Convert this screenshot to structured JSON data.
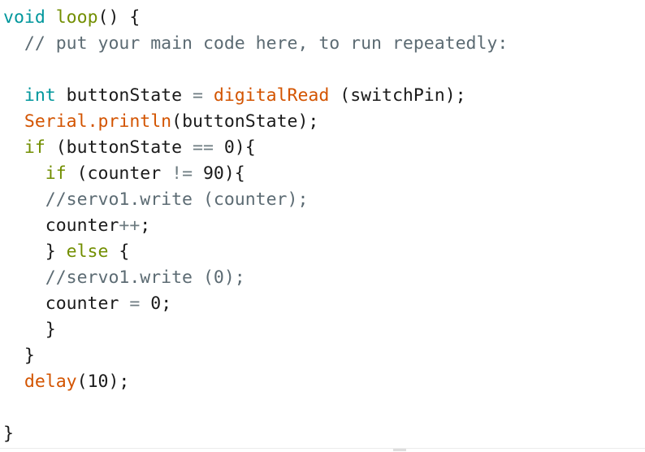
{
  "editor": {
    "language": "arduino",
    "background_color": "#ffffff",
    "font_size_px": 21.5,
    "line_height_px": 32,
    "colors": {
      "type": "#00979C",
      "keyword": "#728E00",
      "function": "#D35400",
      "comment": "#5C6B73",
      "operator": "#6D7B80",
      "plain": "#1a1a1a",
      "divider": "#ececec"
    },
    "full_text": "void loop() {\n  // put your main code here, to run repeatedly:\n\n  int buttonState = digitalRead (switchPin);\n  Serial.println(buttonState);\n  if (buttonState == 0){\n    if (counter != 90){\n    //servo1.write (counter);\n    counter++;\n    } else {\n    //servo1.write (0);\n    counter = 0;\n    }\n  }\n  delay(10);\n\n}",
    "lines": [
      {
        "indent": "",
        "tokens": [
          {
            "t": "void",
            "k": "type"
          },
          {
            "t": " ",
            "k": "plain"
          },
          {
            "t": "loop",
            "k": "keyword"
          },
          {
            "t": "() {",
            "k": "punct"
          }
        ]
      },
      {
        "indent": "  ",
        "tokens": [
          {
            "t": "// put your main code here, to run repeatedly:",
            "k": "comment"
          }
        ]
      },
      {
        "indent": "",
        "tokens": []
      },
      {
        "indent": "  ",
        "tokens": [
          {
            "t": "int",
            "k": "type"
          },
          {
            "t": " buttonState ",
            "k": "plain"
          },
          {
            "t": "=",
            "k": "operator"
          },
          {
            "t": " ",
            "k": "plain"
          },
          {
            "t": "digitalRead",
            "k": "function"
          },
          {
            "t": " (switchPin);",
            "k": "punct"
          }
        ]
      },
      {
        "indent": "  ",
        "tokens": [
          {
            "t": "Serial",
            "k": "function"
          },
          {
            "t": ".",
            "k": "function"
          },
          {
            "t": "println",
            "k": "function"
          },
          {
            "t": "(buttonState);",
            "k": "punct"
          }
        ]
      },
      {
        "indent": "  ",
        "tokens": [
          {
            "t": "if",
            "k": "keyword"
          },
          {
            "t": " (buttonState ",
            "k": "punct"
          },
          {
            "t": "==",
            "k": "operator"
          },
          {
            "t": " ",
            "k": "plain"
          },
          {
            "t": "0",
            "k": "number"
          },
          {
            "t": "){",
            "k": "punct"
          }
        ]
      },
      {
        "indent": "    ",
        "tokens": [
          {
            "t": "if",
            "k": "keyword"
          },
          {
            "t": " (counter ",
            "k": "punct"
          },
          {
            "t": "!=",
            "k": "operator"
          },
          {
            "t": " ",
            "k": "plain"
          },
          {
            "t": "90",
            "k": "number"
          },
          {
            "t": "){",
            "k": "punct"
          }
        ]
      },
      {
        "indent": "    ",
        "tokens": [
          {
            "t": "//servo1.write (counter);",
            "k": "comment"
          }
        ]
      },
      {
        "indent": "    ",
        "tokens": [
          {
            "t": "counter",
            "k": "plain"
          },
          {
            "t": "++",
            "k": "operator"
          },
          {
            "t": ";",
            "k": "punct"
          }
        ]
      },
      {
        "indent": "    ",
        "tokens": [
          {
            "t": "} ",
            "k": "punct"
          },
          {
            "t": "else",
            "k": "keyword"
          },
          {
            "t": " {",
            "k": "punct"
          }
        ]
      },
      {
        "indent": "    ",
        "tokens": [
          {
            "t": "//servo1.write (0);",
            "k": "comment"
          }
        ]
      },
      {
        "indent": "    ",
        "tokens": [
          {
            "t": "counter ",
            "k": "plain"
          },
          {
            "t": "=",
            "k": "operator"
          },
          {
            "t": " ",
            "k": "plain"
          },
          {
            "t": "0",
            "k": "number"
          },
          {
            "t": ";",
            "k": "punct"
          }
        ]
      },
      {
        "indent": "    ",
        "tokens": [
          {
            "t": "}",
            "k": "punct"
          }
        ]
      },
      {
        "indent": "  ",
        "tokens": [
          {
            "t": "}",
            "k": "punct"
          }
        ]
      },
      {
        "indent": "  ",
        "tokens": [
          {
            "t": "delay",
            "k": "function"
          },
          {
            "t": "(",
            "k": "punct"
          },
          {
            "t": "10",
            "k": "number"
          },
          {
            "t": ");",
            "k": "punct"
          }
        ]
      },
      {
        "indent": "",
        "tokens": []
      },
      {
        "indent": "",
        "tokens": [
          {
            "t": "}",
            "k": "punct"
          }
        ]
      }
    ]
  }
}
